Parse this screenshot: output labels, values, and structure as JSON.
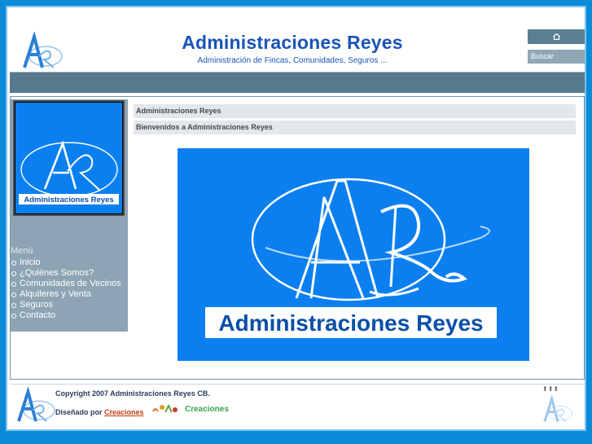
{
  "header": {
    "title": "Administraciones Reyes",
    "subtitle": "Administración de Fincas, Comunidades, Seguros ...",
    "search_label": "Buscar",
    "home_icon": "home-icon"
  },
  "sidebar": {
    "logo_caption": "Administraciones Reyes",
    "menu_title": "Menú",
    "items": [
      {
        "label": "Inicio"
      },
      {
        "label": "¿Quiénes Somos?"
      },
      {
        "label": "Comunidades de Vecinos"
      },
      {
        "label": "Alquileres y Venta"
      },
      {
        "label": "Seguros"
      },
      {
        "label": "Contacto"
      }
    ]
  },
  "main": {
    "crumb_title": "Administraciones Reyes",
    "welcome": "Bienvenidos a Administraciones Reyes",
    "banner_caption": "Administraciones Reyes",
    "banner_monogram": "AR"
  },
  "footer": {
    "copyright": "Copyright 2007 Administraciones Reyes CB.",
    "designed_by": "Diseñado por",
    "designer_link": "Creaciones",
    "designer_logo_text": "Creaciones"
  },
  "colors": {
    "page_background": "#0a8cd9",
    "brand_blue": "#1a54b8",
    "nav_bar": "#56798c",
    "logo_blue": "#0b7ff0"
  }
}
